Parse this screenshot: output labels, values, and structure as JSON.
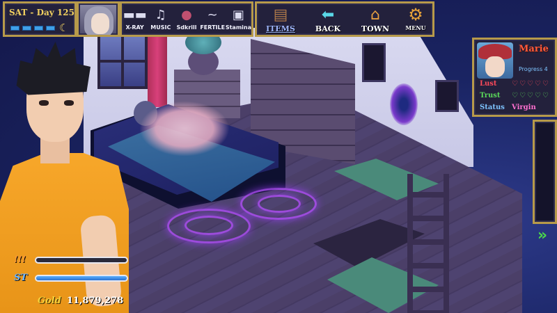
{
  "hud": {
    "date": "SAT - Day 125",
    "energy_segments": 4,
    "time_icon": "crescent-moon-icon"
  },
  "skills": [
    {
      "id": "xray",
      "label": "X-RAY",
      "icon": "sunglasses-icon",
      "glyph": "▬▬"
    },
    {
      "id": "music",
      "label": "MUSIC",
      "icon": "music-note-icon",
      "glyph": "♫"
    },
    {
      "id": "seduction",
      "label": "Sdkrill",
      "icon": "seduction-orb-icon",
      "glyph": "●"
    },
    {
      "id": "fertile",
      "label": "FERTILE",
      "icon": "fertile-swirl-icon",
      "glyph": "~"
    },
    {
      "id": "stamina",
      "label": "Stamina",
      "icon": "stamina-icon",
      "glyph": "▣"
    }
  ],
  "nav": {
    "items": {
      "label": "ITEMS",
      "icon": "backpack-icon",
      "glyph": "▤"
    },
    "back": {
      "label": "BACK",
      "icon": "back-arrow-icon",
      "glyph": "⬅"
    },
    "town": {
      "label": "TOWN",
      "icon": "map-pin-icon",
      "glyph": "⌂"
    },
    "menu": {
      "label": "MENU",
      "icon": "gear-icon",
      "glyph": "⚙"
    }
  },
  "npc": {
    "name": "Marie",
    "progress": "Progress 4",
    "lust_label": "Lust",
    "lust_hearts": 5,
    "lust_hearts_filled": 0,
    "trust_label": "Trust",
    "trust_hearts": 5,
    "trust_hearts_filled": 0,
    "status_label": "Status",
    "status_value": "Virgin"
  },
  "player": {
    "lust_label": "!!!",
    "lust_fill": 0.0,
    "st_label": "ST",
    "st_fill": 1.0,
    "gold_label": "Gold",
    "gold_value": "11,879,278"
  },
  "colors": {
    "hud_border": "#b79a4a",
    "hud_bg": "#23213c",
    "date_text": "#f0d060",
    "npc_name": "#ff5a3a",
    "trust": "#5ad85a",
    "lust": "#ff4a5a",
    "status_value": "#ff70d0",
    "gold": "#f5d03a",
    "energy": "#3fa0e8"
  },
  "next_arrow": "»"
}
